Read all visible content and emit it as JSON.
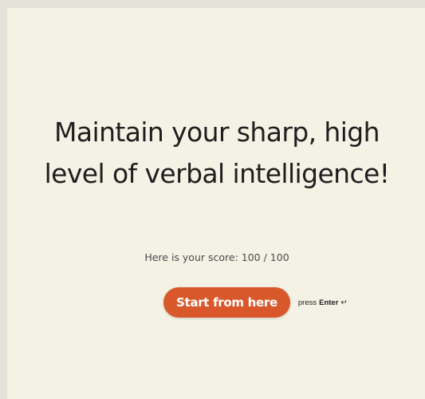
{
  "main": {
    "heading": "Maintain your sharp, high level of verbal intelligence!",
    "score_prefix": "Here is your score:",
    "score_value": "100 / 100"
  },
  "cta": {
    "button_label": "Start from here",
    "hint_prefix": "press",
    "hint_key": "Enter",
    "hint_icon": "enter-return-icon"
  },
  "colors": {
    "background": "#f4f2e5",
    "outer_background": "#e3e3d9",
    "accent": "#d9582b",
    "text": "#1e1e1e"
  }
}
